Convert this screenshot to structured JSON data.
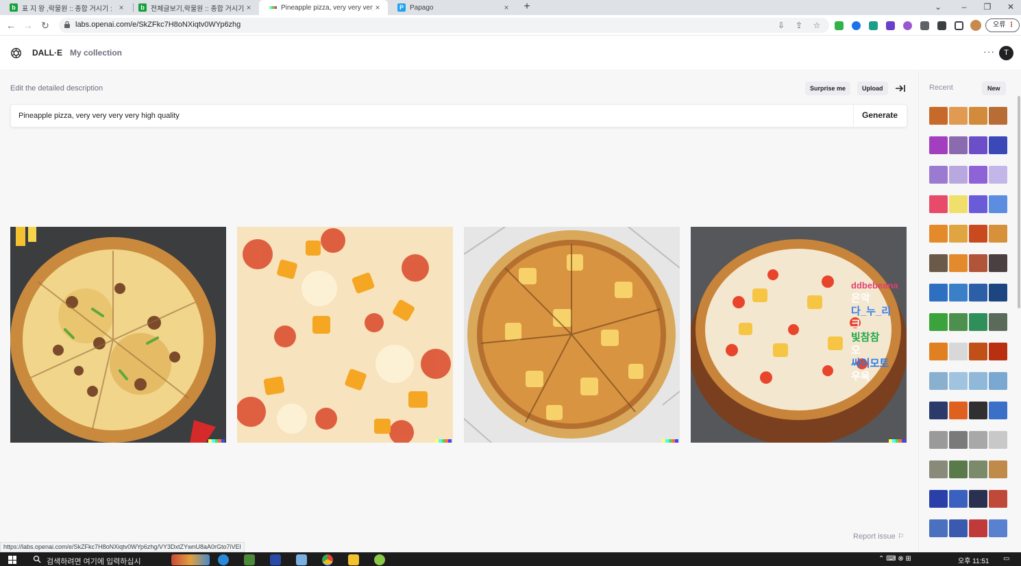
{
  "browser": {
    "tabs": [
      {
        "title": "표 지 왕 ,락물원 :: 종합 거시기 :",
        "favicon_color": "#17a13b",
        "active": false
      },
      {
        "title": "전체글보기,락물원 :: 종합 거시기",
        "favicon_color": "#17a13b",
        "active": false
      },
      {
        "title": "Pineapple pizza, very very very",
        "favicon_color": "#7b61ff",
        "active": true
      },
      {
        "title": "Papago",
        "favicon_color": "#1ea2f1",
        "active": false
      }
    ],
    "close_glyph": "×",
    "new_tab_glyph": "+",
    "url": "labs.openai.com/e/SkZFkc7H8oNXiqtv0WYp6zhg",
    "menu_label": "오류",
    "menu_dots": "⋮"
  },
  "app": {
    "brand": "DALL·E",
    "nav_collection": "My collection",
    "more_glyph": "···",
    "avatar_initial": "T",
    "edit_label": "Edit the detailed description",
    "surprise_label": "Surprise me",
    "upload_label": "Upload",
    "prompt_value": "Pineapple pizza, very very very very high quality",
    "generate_label": "Generate",
    "report_label": "Report issue ⚐",
    "watermark_colors": [
      "#ffff66",
      "#42ffff",
      "#51da4c",
      "#ff6e3c",
      "#3c46ff"
    ],
    "overlay_texts": [
      {
        "text": "ddbebeana",
        "color": "#e04070"
      },
      {
        "text": "은악",
        "color": "#ffffff"
      },
      {
        "text": "다_누_리",
        "color": "#3a7ff0"
      },
      {
        "text": "크",
        "color": "#ffffff"
      },
      {
        "text": "빛참참",
        "color": "#23a84a"
      },
      {
        "text": "오",
        "color": "#ffffff"
      },
      {
        "text": "싸이모토",
        "color": "#2a79e8"
      },
      {
        "text": "우욱",
        "color": "#ffffff"
      }
    ]
  },
  "sidebar": {
    "recent_label": "Recent",
    "new_label": "New",
    "thumb_rows": [
      [
        "#c7692a",
        "#e19a52",
        "#d28b3a",
        "#b86d34"
      ],
      [
        "#a33fbf",
        "#8a6bb0",
        "#6b4fc9",
        "#3b49b8"
      ],
      [
        "#9a7bd1",
        "#b9a8e0",
        "#8f63d8",
        "#c2b7e8"
      ],
      [
        "#e84a6a",
        "#f0e06b",
        "#6a5bd8",
        "#5b8ee0"
      ],
      [
        "#e58a2a",
        "#e0a440",
        "#c94a1e",
        "#d6913a"
      ],
      [
        "#6b5a4a",
        "#e38b2c",
        "#b0543a",
        "#4a4040"
      ],
      [
        "#2e6fc1",
        "#3b7fc9",
        "#2c5fa8",
        "#1d4580"
      ],
      [
        "#3ba33b",
        "#4d8f4d",
        "#2f8f5a",
        "#5a6b5a"
      ],
      [
        "#e08020",
        "#d8d8d8",
        "#c05018",
        "#b83010"
      ],
      [
        "#8ab0d0",
        "#a0c4e0",
        "#90b8d8",
        "#7aa8d0"
      ],
      [
        "#2a3a6a",
        "#e06020",
        "#303030",
        "#3a70c8"
      ],
      [
        "#9a9a9a",
        "#7a7a7a",
        "#a8a8a8",
        "#c8c8c8"
      ],
      [
        "#8a8a7a",
        "#5a7a4a",
        "#7a8a6a",
        "#c08a4a"
      ],
      [
        "#2a40a8",
        "#3a60c0",
        "#2a3050",
        "#c04a3a"
      ],
      [
        "#4a70c0",
        "#3a5ab0",
        "#c03a3a",
        "#5a80d0"
      ]
    ]
  },
  "status_bar": {
    "link_preview": "https://labs.openai.com/e/SkZFkc7H8oNXiqtv0WYp6zhg/VY3DxtZYwnU8aA0rGto7iVEl"
  },
  "taskbar": {
    "search_placeholder": "검색하려면 여기에 입력하십시",
    "time": "오후 11:51"
  }
}
